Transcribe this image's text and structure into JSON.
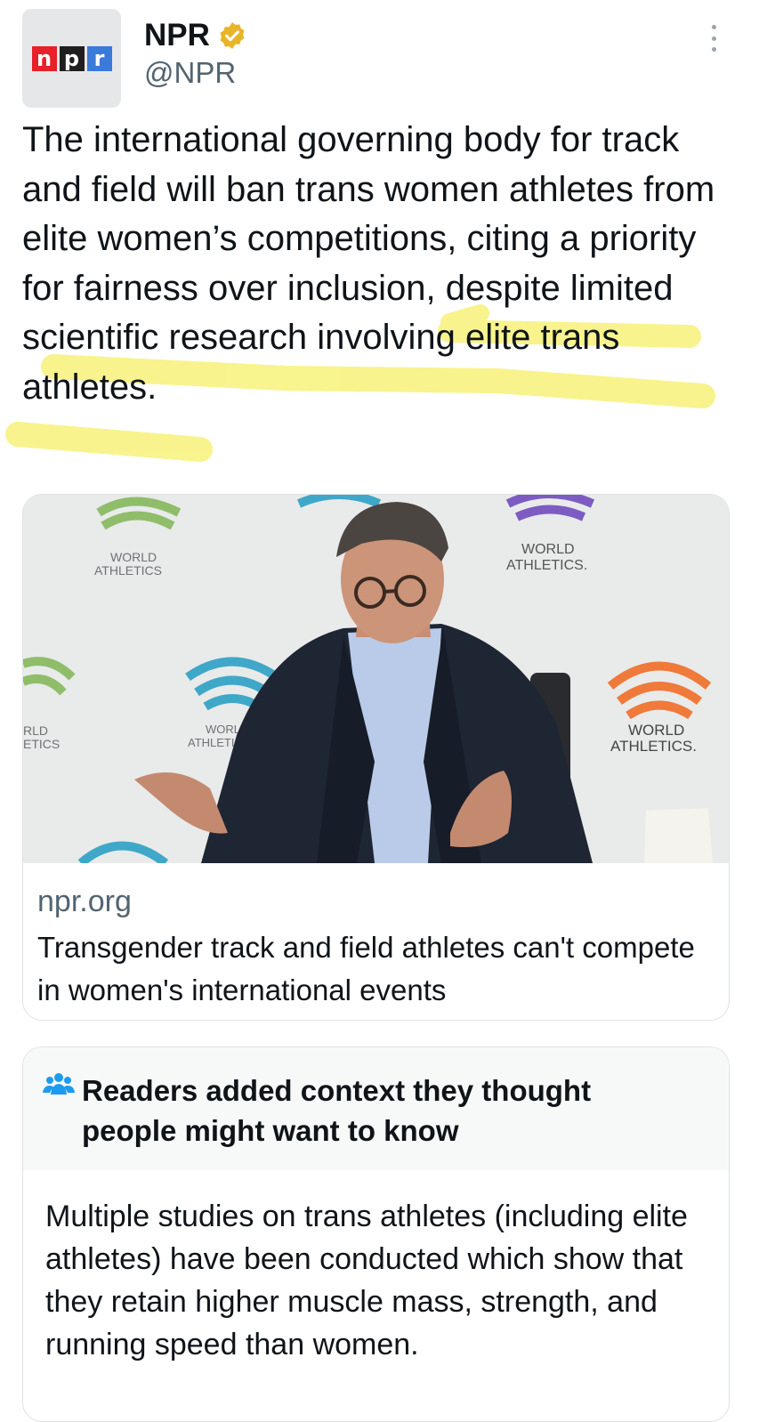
{
  "author": {
    "display_name": "NPR",
    "handle": "@NPR",
    "verified": true,
    "logo_letters": [
      "n",
      "p",
      "r"
    ]
  },
  "tweet": {
    "text": "The international governing body for track and field will ban trans women athletes from elite women’s competitions, citing a priority for fairness over inclusion, despite limited scientific research involving elite trans athletes."
  },
  "link_card": {
    "domain": "npr.org",
    "title": "Transgender track and field athletes can't compete in women's international events",
    "image_texts": [
      "WORLD ATHLETICS",
      "WORLD ATHLETICS",
      "WORLD ATHLETICS",
      "RLD ETICS",
      "WORLD ATHLETICS",
      "WORLD ATHLETICS"
    ]
  },
  "community_note": {
    "title": "Readers added context they thought people might want to know",
    "body": "Multiple studies on trans athletes (including elite athletes) have been conducted which show that they retain higher muscle mass, strength, and running speed than women."
  },
  "colors": {
    "highlight": "#f7f27a",
    "verified_badge": "#e8b528",
    "note_icon": "#1d9bf0"
  },
  "icons": [
    "more-vertical-icon",
    "verified-badge-icon",
    "people-icon"
  ]
}
